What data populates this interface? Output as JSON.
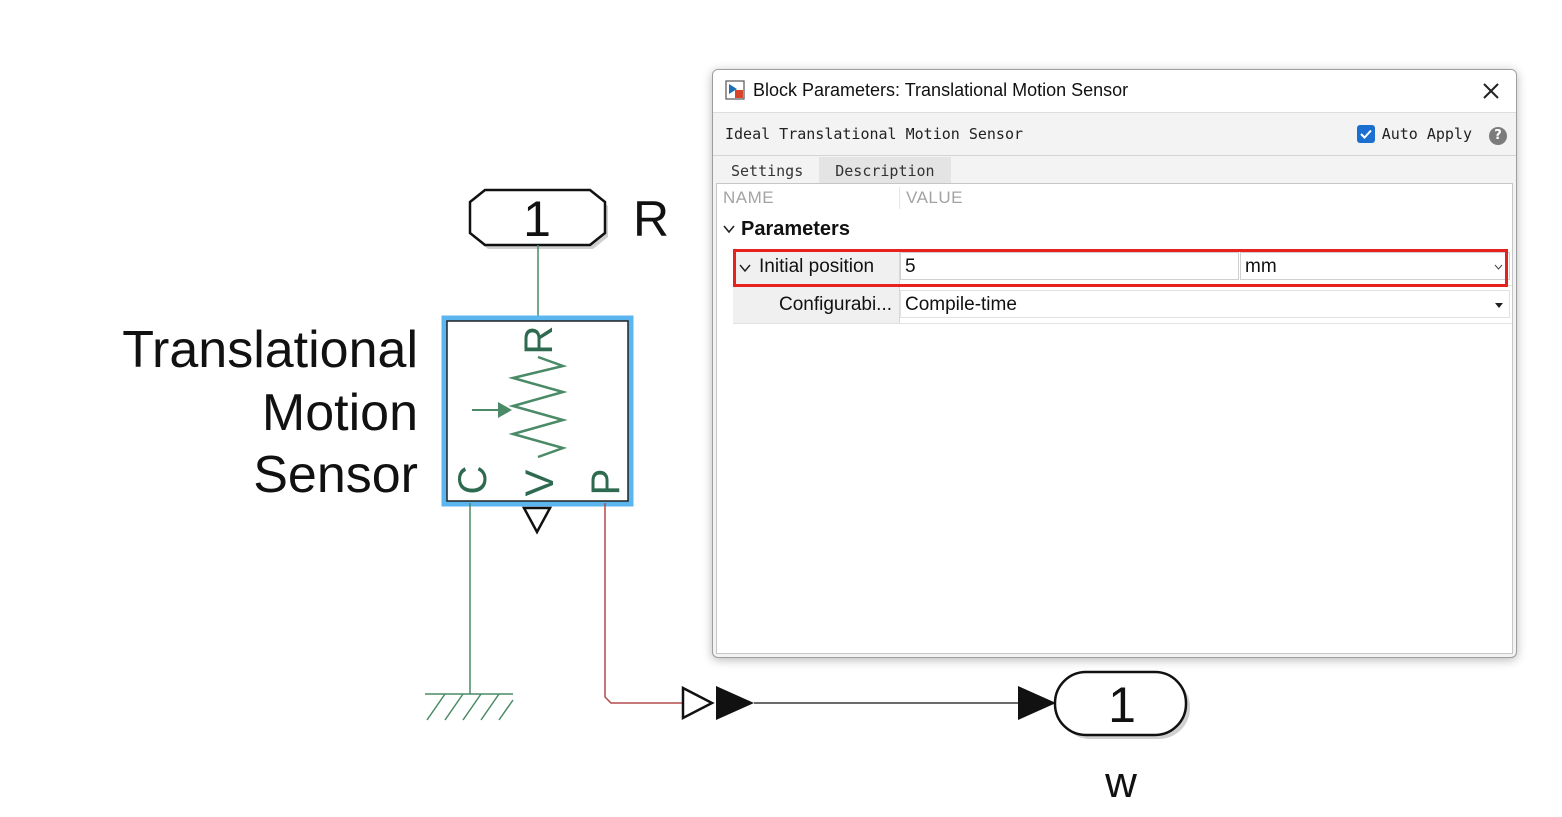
{
  "diagram": {
    "block_name": [
      "Translational",
      "Motion",
      "Sensor"
    ],
    "in_port": {
      "number": "1",
      "label": "R"
    },
    "out_port": {
      "number": "1",
      "label": "w"
    },
    "port_labels": {
      "top": "R",
      "left": "C",
      "middle": "V",
      "right": "P"
    }
  },
  "dialog": {
    "title": "Block Parameters: Translational Motion Sensor",
    "description": "Ideal Translational Motion Sensor",
    "auto_apply_label": "Auto Apply",
    "auto_apply_checked": true,
    "help_glyph": "?",
    "tabs": [
      {
        "label": "Settings",
        "active": true
      },
      {
        "label": "Description",
        "active": false
      }
    ],
    "columns": {
      "name": "NAME",
      "value": "VALUE"
    },
    "group_label": "Parameters",
    "params": [
      {
        "name": "Initial position",
        "value": "5",
        "unit": "mm",
        "expanded": true,
        "highlighted": true
      },
      {
        "name": "Configurabi...",
        "value": "Compile-time"
      }
    ]
  },
  "colors": {
    "block_border": "#5bb5ee",
    "physical_line": "#4a8a66",
    "signal_line_red": "#b34a4a",
    "highlight": "#e8201e",
    "checkbox": "#1a6fd1"
  },
  "icons": [
    "app-block-icon",
    "close-icon",
    "chevron-down-icon",
    "help-icon",
    "check-icon",
    "dropdown-arrow-icon"
  ]
}
